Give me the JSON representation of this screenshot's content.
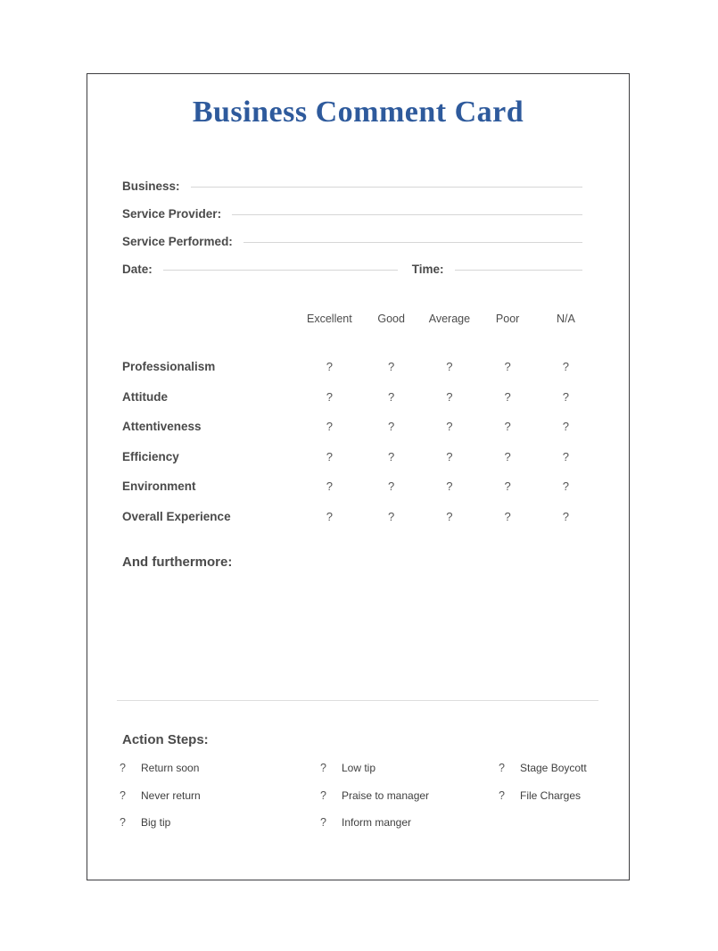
{
  "document": {
    "title": "Business Comment Card",
    "title_color": "#2e5a9c",
    "border_color": "#3d3d40",
    "rule_color": "#d6d6d6",
    "divider_color": "#dedede",
    "text_color": "#4a4a4a"
  },
  "fields": [
    {
      "label": "Business:",
      "value": ""
    },
    {
      "label": "Service Provider:",
      "value": ""
    },
    {
      "label": "Service Performed:",
      "value": ""
    }
  ],
  "datetime": {
    "date_label": "Date:",
    "date_value": "",
    "time_label": "Time:",
    "time_value": ""
  },
  "ratings": {
    "columns": [
      "Excellent",
      "Good",
      "Average",
      "Poor",
      "N/A"
    ],
    "rows": [
      {
        "label": "Professionalism",
        "marks": [
          "?",
          "?",
          "?",
          "?",
          "?"
        ]
      },
      {
        "label": "Attitude",
        "marks": [
          "?",
          "?",
          "?",
          "?",
          "?"
        ]
      },
      {
        "label": "Attentiveness",
        "marks": [
          "?",
          "?",
          "?",
          "?",
          "?"
        ]
      },
      {
        "label": "Efficiency",
        "marks": [
          "?",
          "?",
          "?",
          "?",
          "?"
        ]
      },
      {
        "label": "Environment",
        "marks": [
          "?",
          "?",
          "?",
          "?",
          "?"
        ]
      },
      {
        "label": "Overall Experience",
        "marks": [
          "?",
          "?",
          "?",
          "?",
          "?"
        ]
      }
    ]
  },
  "furthermore": {
    "heading": "And furthermore:",
    "value": ""
  },
  "action_steps": {
    "heading": "Action Steps:",
    "columns": [
      [
        {
          "box": "?",
          "label": "Return soon"
        },
        {
          "box": "?",
          "label": "Never return"
        },
        {
          "box": "?",
          "label": "Big tip"
        }
      ],
      [
        {
          "box": "?",
          "label": "Low tip"
        },
        {
          "box": "?",
          "label": "Praise to manager"
        },
        {
          "box": "?",
          "label": "Inform manger"
        }
      ],
      [
        {
          "box": "?",
          "label": "Stage Boycott"
        },
        {
          "box": "?",
          "label": "File Charges"
        }
      ]
    ]
  }
}
